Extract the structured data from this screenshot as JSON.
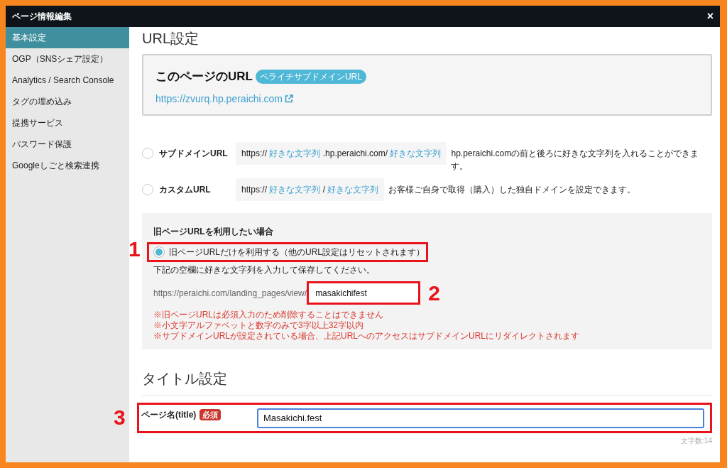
{
  "window": {
    "title": "ページ情報編集",
    "close": "×"
  },
  "sidebar": {
    "items": [
      {
        "label": "基本設定",
        "selected": true
      },
      {
        "label": "OGP（SNSシェア設定）",
        "selected": false
      },
      {
        "label": "Analytics / Search Console",
        "selected": false
      },
      {
        "label": "タグの埋め込み",
        "selected": false
      },
      {
        "label": "提携サービス",
        "selected": false
      },
      {
        "label": "パスワード保護",
        "selected": false
      },
      {
        "label": "Googleしごと検索連携",
        "selected": false
      }
    ]
  },
  "url_section": {
    "heading": "URL設定",
    "current": {
      "title": "このページのURL",
      "badge": "ペライチサブドメインURL",
      "link": "https://zvurq.hp.peraichi.com"
    },
    "options": [
      {
        "label": "サブドメインURL",
        "selected": false,
        "parts": [
          {
            "text": "https://",
            "kind": "fixed"
          },
          {
            "text": "好きな文字列",
            "kind": "variable"
          },
          {
            "text": ".hp.peraichi.com/",
            "kind": "fixed"
          },
          {
            "text": "好きな文字列",
            "kind": "variable"
          }
        ],
        "description": "hp.peraichi.comの前と後ろに好きな文字列を入れることができます。"
      },
      {
        "label": "カスタムURL",
        "selected": false,
        "parts": [
          {
            "text": "https://",
            "kind": "fixed"
          },
          {
            "text": "好きな文字列",
            "kind": "variable"
          },
          {
            "text": "/",
            "kind": "fixed"
          },
          {
            "text": "好きな文字列",
            "kind": "variable"
          }
        ],
        "description": "お客様ご自身で取得（購入）した独自ドメインを設定できます。"
      }
    ]
  },
  "legacy": {
    "heading": "旧ページURLを利用したい場合",
    "option": {
      "label": "旧ページURLだけを利用する（他のURL設定はリセットされます）",
      "selected": true,
      "annotation": "1"
    },
    "instruction": "下記の空欄に好きな文字列を入力して保存してください。",
    "prefix": "https://peraichi.com/landing_pages/view/",
    "value": "masakichifest",
    "annotation": "2",
    "notes": [
      "※旧ページURLは必須入力のため削除することはできません",
      "※小文字アルファベットと数字のみで3字以上32字以内",
      "※サブドメインURLが設定されている場合、上記URLへのアクセスはサブドメインURLにリダイレクトされます"
    ]
  },
  "title_section": {
    "heading": "タイトル設定",
    "label": "ページ名(title)",
    "badge": "必須",
    "value": "Masakichi.fest",
    "annotation": "3",
    "counter": "文字数:14"
  }
}
